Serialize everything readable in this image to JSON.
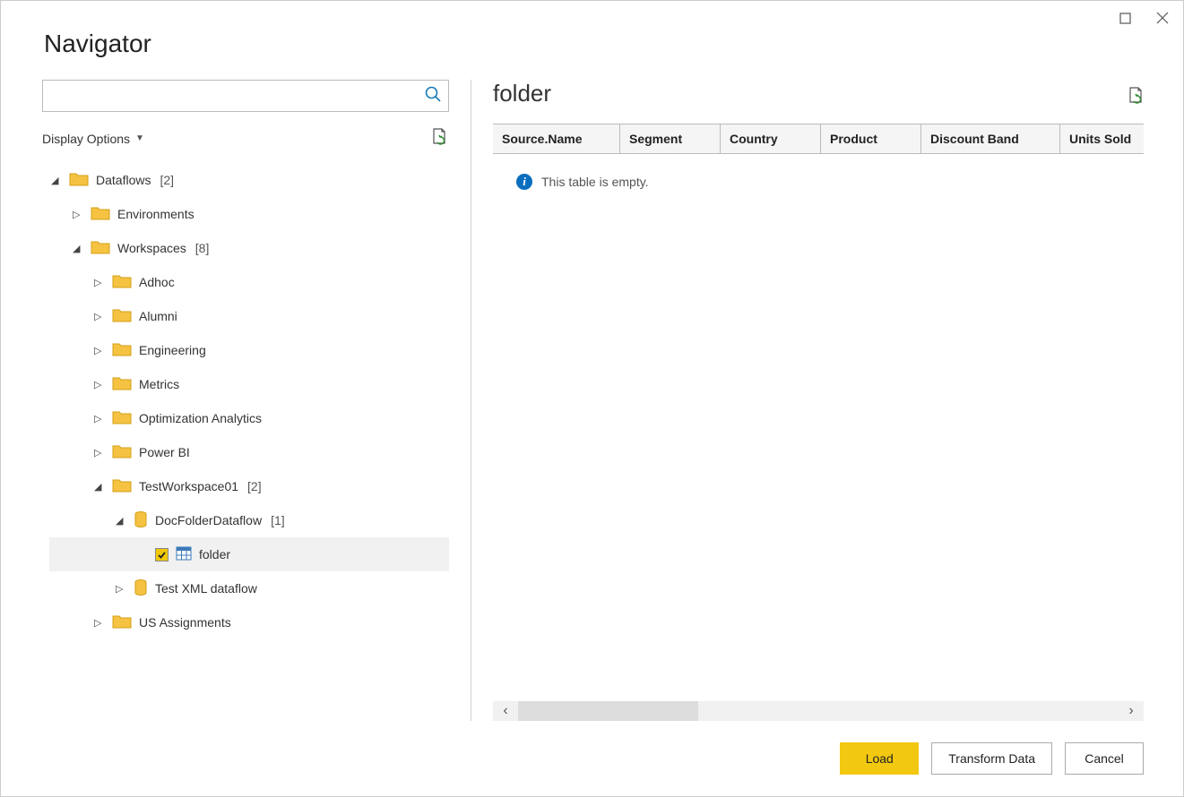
{
  "window": {
    "title": "Navigator"
  },
  "left": {
    "search_placeholder": "",
    "display_options_label": "Display Options",
    "tree": {
      "dataflows_label": "Dataflows",
      "dataflows_count": "[2]",
      "environments_label": "Environments",
      "workspaces_label": "Workspaces",
      "workspaces_count": "[8]",
      "adhoc_label": "Adhoc",
      "alumni_label": "Alumni",
      "engineering_label": "Engineering",
      "metrics_label": "Metrics",
      "optimization_label": "Optimization Analytics",
      "powerbi_label": "Power BI",
      "testws_label": "TestWorkspace01",
      "testws_count": "[2]",
      "docfolder_label": "DocFolderDataflow",
      "docfolder_count": "[1]",
      "folder_label": "folder",
      "testxml_label": "Test XML dataflow",
      "usassign_label": "US Assignments"
    }
  },
  "preview": {
    "title": "folder",
    "columns": [
      "Source.Name",
      "Segment",
      "Country",
      "Product",
      "Discount Band",
      "Units Sold"
    ],
    "empty_message": "This table is empty."
  },
  "footer": {
    "load_label": "Load",
    "transform_label": "Transform Data",
    "cancel_label": "Cancel"
  }
}
